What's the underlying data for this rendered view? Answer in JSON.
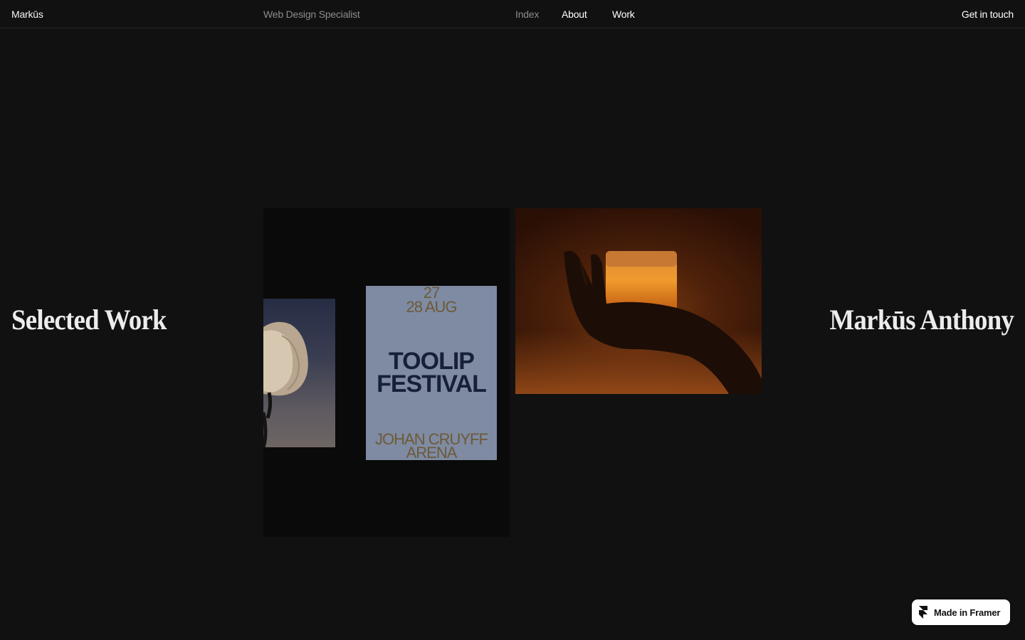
{
  "header": {
    "brand": "Markūs",
    "tagline": "Web Design Specialist",
    "nav": [
      {
        "label": "Index"
      },
      {
        "label": "About"
      },
      {
        "label": "Work"
      }
    ],
    "cta": "Get in touch"
  },
  "hero": {
    "left_title": "Selected Work",
    "right_title": "Markūs Anthony"
  },
  "projects": [
    {
      "poster": {
        "date_line1": "27",
        "date_line2": "28 AUG",
        "title_line1": "TOOLIP",
        "title_line2": "FESTIVAL",
        "venue_line1": "JOHAN CRUYFF",
        "venue_line2": "ARENA"
      },
      "images": [
        "tulip-photo",
        "festival-poster"
      ]
    },
    {
      "images": [
        "hand-holding-candle-jar-photo"
      ]
    }
  ],
  "badge": {
    "label": "Made in Framer",
    "icon": "framer-logo-icon"
  },
  "colors": {
    "background": "#111111",
    "poster_bg": "#7f8ba3",
    "poster_title": "#172038",
    "poster_accent": "#6c5a37",
    "candle_glow": "#e6861f"
  }
}
